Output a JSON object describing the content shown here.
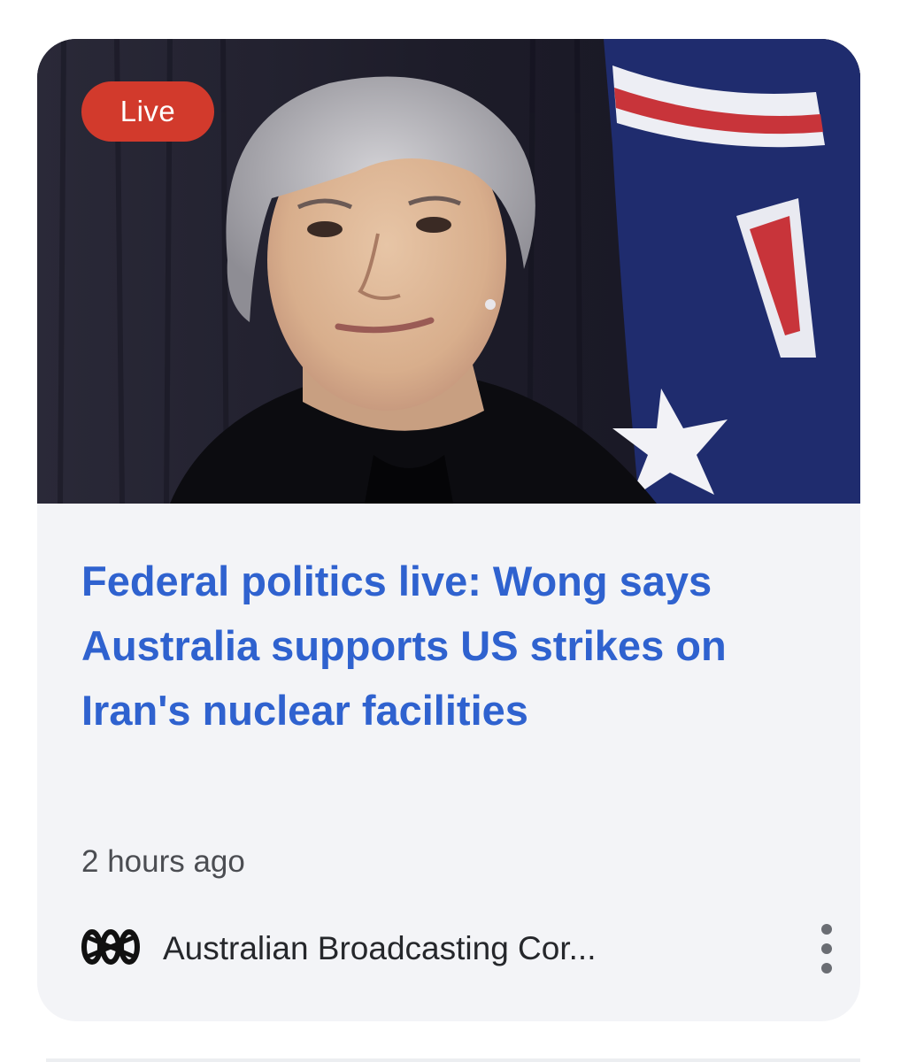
{
  "card": {
    "badge_label": "Live",
    "image_description": "",
    "headline": "Federal politics live: Wong says Australia supports US strikes on Iran's nuclear facilities",
    "timestamp": "2 hours ago",
    "source_name": "Australian Broadcasting Cor...",
    "source_logo_icon": "abc-logo-icon",
    "more_icon": "more-vert-icon"
  },
  "colors": {
    "badge_background": "#d23a2c",
    "headline_link": "#2f62cf",
    "card_background": "#f3f4f7",
    "meta_text": "#4b4d52"
  }
}
